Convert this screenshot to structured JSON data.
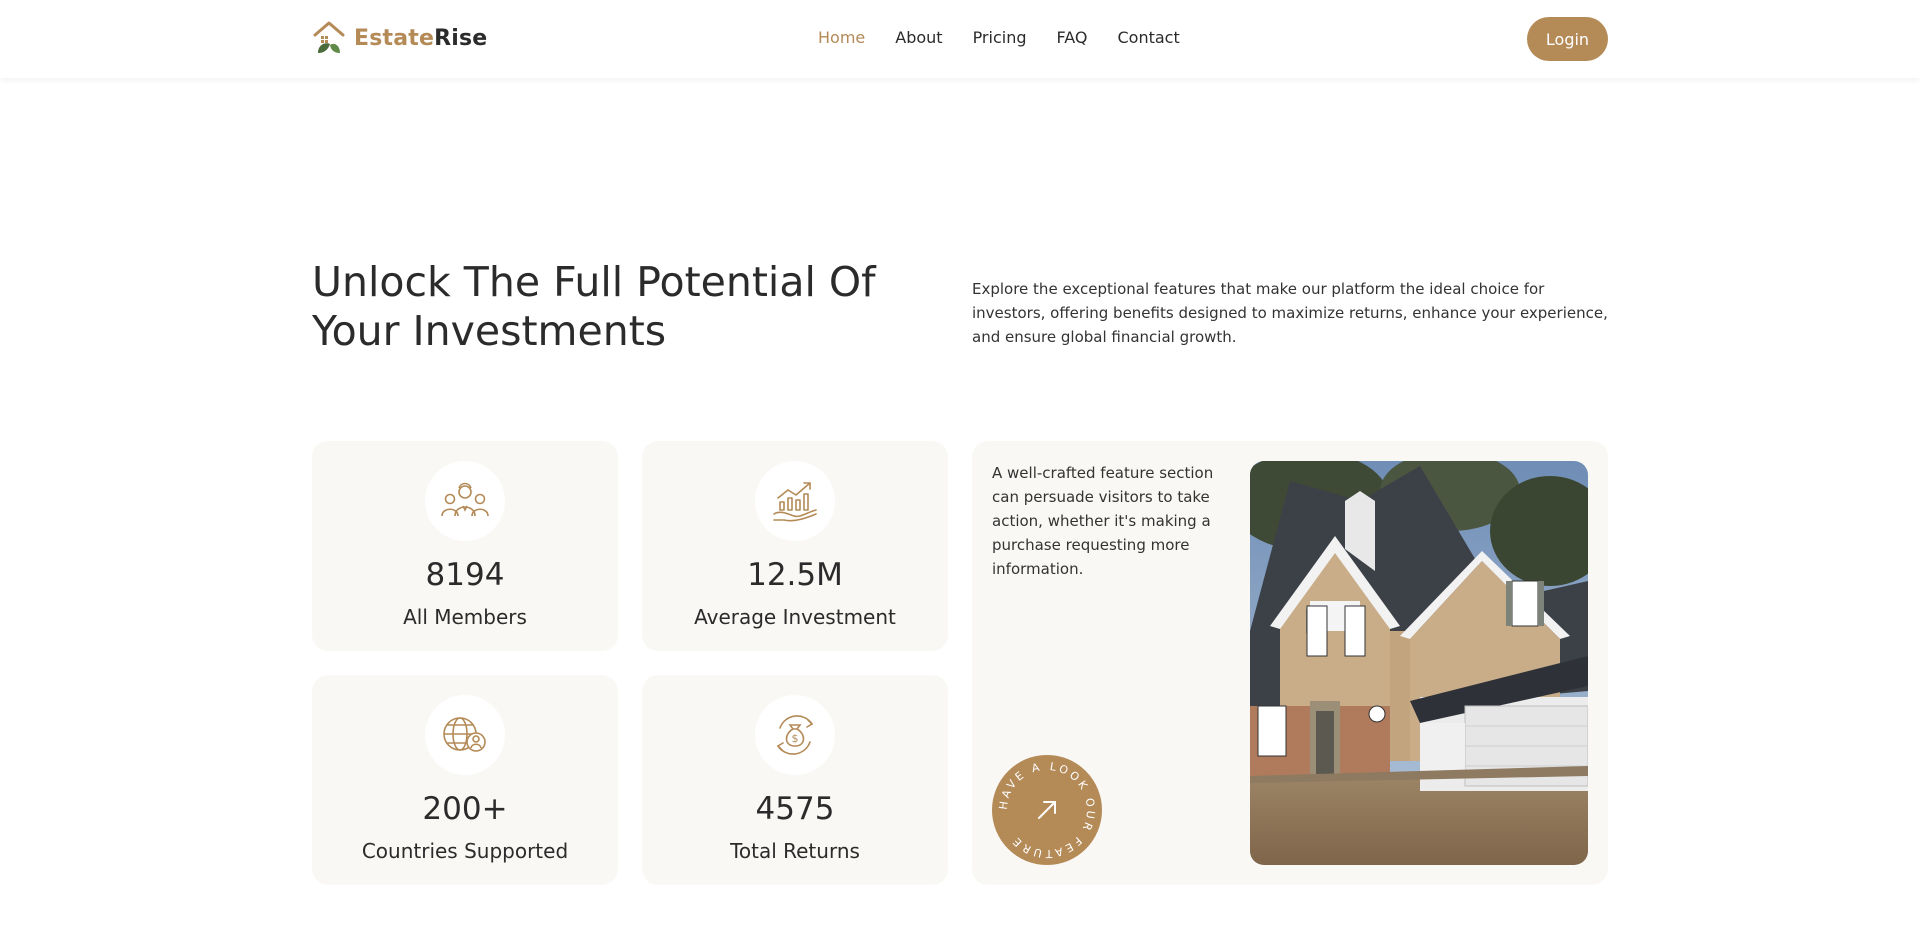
{
  "brand": {
    "name_part1": "Estate",
    "name_part2": "Rise"
  },
  "nav": {
    "items": [
      {
        "label": "Home",
        "active": true
      },
      {
        "label": "About"
      },
      {
        "label": "Pricing"
      },
      {
        "label": "FAQ"
      },
      {
        "label": "Contact"
      }
    ],
    "login_label": "Login"
  },
  "hero": {
    "title": "Unlock The Full Potential Of Your Investments",
    "description": "Explore the exceptional features that make our platform the ideal choice for investors, offering benefits designed to maximize returns, enhance your experience, and ensure global financial growth."
  },
  "stats": [
    {
      "value": "8194",
      "label": "All Members",
      "icon": "members-icon"
    },
    {
      "value": "12.5M",
      "label": "Average Investment",
      "icon": "investment-growth-icon"
    },
    {
      "value": "200+",
      "label": "Countries Supported",
      "icon": "globe-user-icon"
    },
    {
      "value": "4575",
      "label": "Total Returns",
      "icon": "money-bag-icon"
    }
  ],
  "feature": {
    "text": "A well-crafted feature section can persuade visitors to take action, whether it's making a purchase requesting more information.",
    "circle_text": "HAVE A LOOK OUR FEATURE"
  },
  "colors": {
    "accent": "#b48a57",
    "card_bg": "#faf8f5",
    "text": "#2b2b2b"
  }
}
